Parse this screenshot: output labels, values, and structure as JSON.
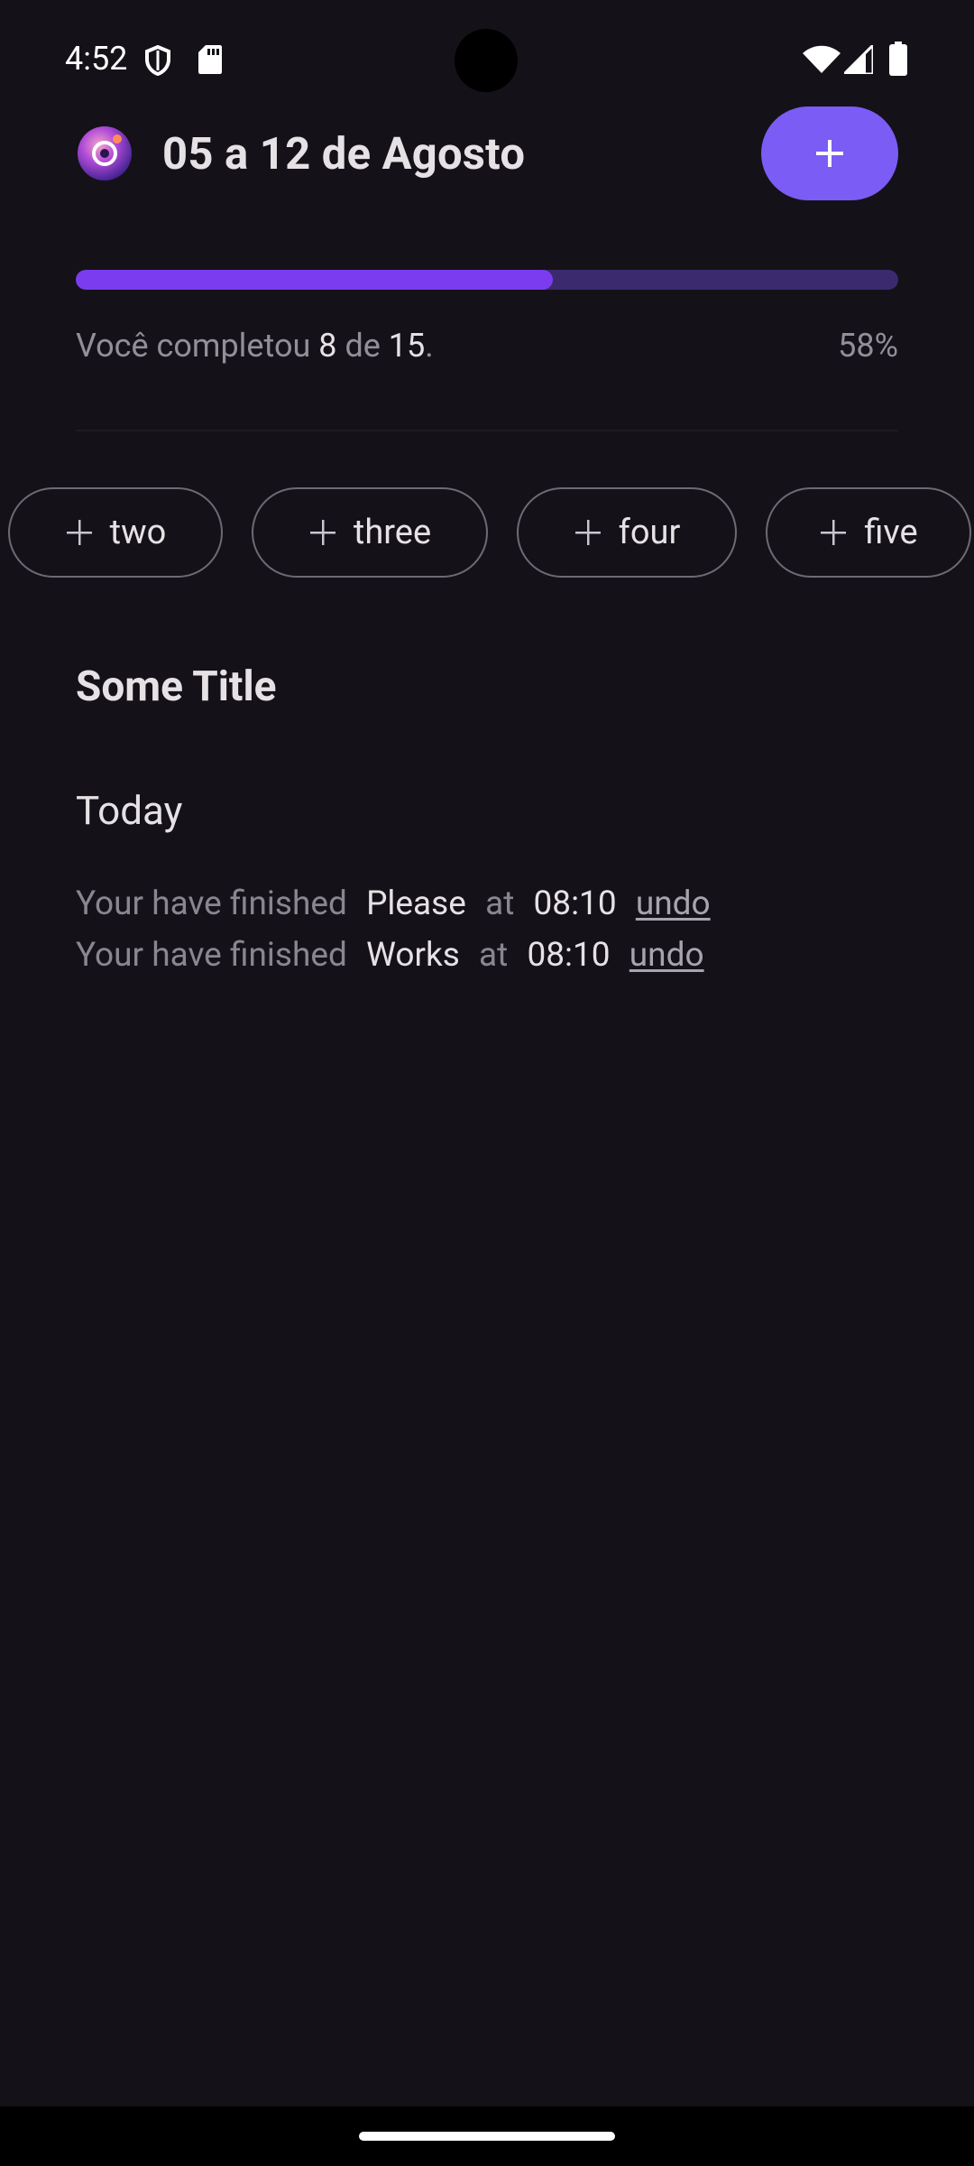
{
  "status_bar": {
    "time": "4:52",
    "left_icons": [
      "shield-icon",
      "sd-card-icon"
    ],
    "right_icons": [
      "wifi-icon",
      "signal-icon",
      "battery-icon"
    ]
  },
  "header": {
    "title": "05 a 12 de Agosto",
    "logo_icon": "app-logo-icon",
    "add_button_icon": "plus-icon"
  },
  "progress": {
    "prefix": "Você completou",
    "done": "8",
    "middle": "de",
    "total": "15",
    "suffix": ".",
    "percent_label": "58%",
    "fraction": 0.58
  },
  "chips": [
    {
      "label": "two",
      "icon": "plus-icon"
    },
    {
      "label": "three",
      "icon": "plus-icon"
    },
    {
      "label": "four",
      "icon": "plus-icon"
    },
    {
      "label": "five",
      "icon": "plus-icon"
    }
  ],
  "section": {
    "title": "Some Title",
    "day": "Today"
  },
  "history": [
    {
      "prefix": "Your have finished",
      "item": "Please",
      "at": "at",
      "time": "08:10",
      "action": "undo"
    },
    {
      "prefix": "Your have finished",
      "item": "Works",
      "at": "at",
      "time": "08:10",
      "action": "undo"
    }
  ],
  "colors": {
    "background": "#141218",
    "accent": "#7B5CF5",
    "progress_fill": "#7B3CF0",
    "progress_track": "#3B2A6E",
    "text_primary": "#E6E1E5",
    "text_muted": "#938F99"
  }
}
